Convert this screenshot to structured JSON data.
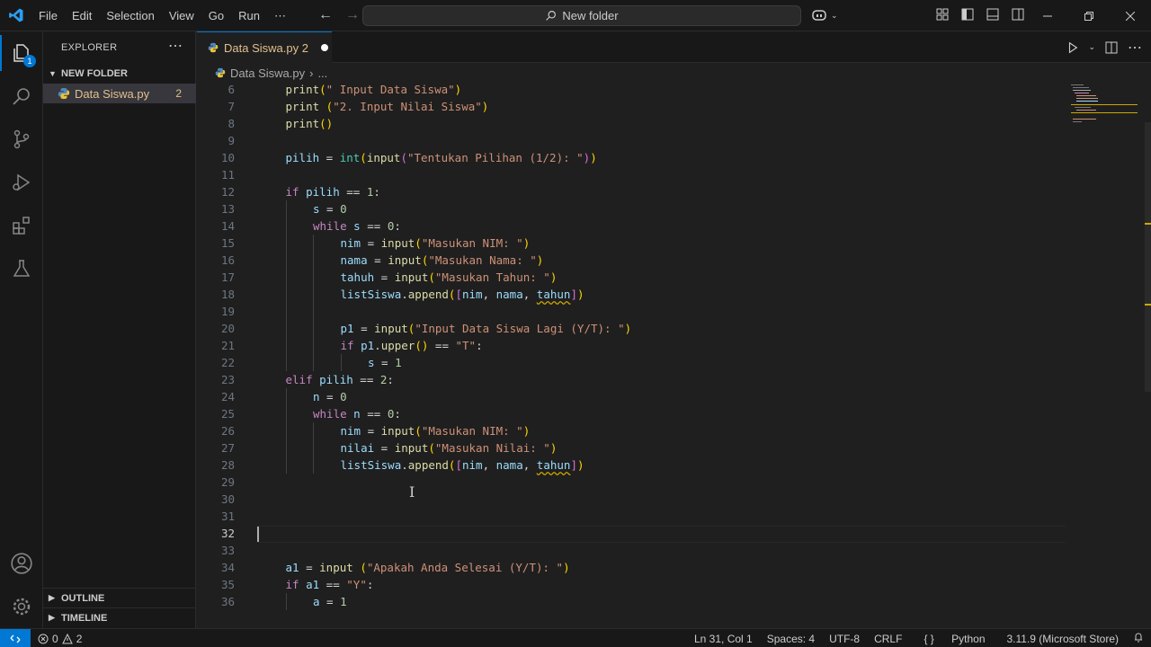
{
  "menu": [
    "File",
    "Edit",
    "Selection",
    "View",
    "Go",
    "Run"
  ],
  "search": {
    "label": "New folder"
  },
  "explorer": {
    "title": "EXPLORER",
    "folder": "NEW FOLDER",
    "file": {
      "name": "Data Siswa.py",
      "problems": "2"
    },
    "outline": "OUTLINE",
    "timeline": "TIMELINE"
  },
  "activity_badge": "1",
  "tab": {
    "label": "Data Siswa.py 2"
  },
  "breadcrumb": {
    "file": "Data Siswa.py",
    "more": "..."
  },
  "editor": {
    "current_line": 32,
    "lines": [
      {
        "n": 6,
        "indent": 1,
        "tokens": [
          [
            "fn",
            "print"
          ],
          [
            "br1",
            "("
          ],
          [
            "st",
            "\" Input Data Siswa\""
          ],
          [
            "br1",
            ")"
          ]
        ]
      },
      {
        "n": 7,
        "indent": 1,
        "tokens": [
          [
            "fn",
            "print"
          ],
          [
            "pl",
            " "
          ],
          [
            "br1",
            "("
          ],
          [
            "st",
            "\"2. Input Nilai Siswa\""
          ],
          [
            "br1",
            ")"
          ]
        ]
      },
      {
        "n": 8,
        "indent": 1,
        "tokens": [
          [
            "fn",
            "print"
          ],
          [
            "br1",
            "()"
          ]
        ]
      },
      {
        "n": 9,
        "indent": 1,
        "tokens": []
      },
      {
        "n": 10,
        "indent": 1,
        "tokens": [
          [
            "vr",
            "pilih"
          ],
          [
            "pl",
            " = "
          ],
          [
            "bi",
            "int"
          ],
          [
            "br1",
            "("
          ],
          [
            "fn",
            "input"
          ],
          [
            "br2",
            "("
          ],
          [
            "st",
            "\"Tentukan Pilihan (1/2): \""
          ],
          [
            "br2",
            ")"
          ],
          [
            "br1",
            ")"
          ]
        ]
      },
      {
        "n": 11,
        "indent": 1,
        "tokens": []
      },
      {
        "n": 12,
        "indent": 1,
        "tokens": [
          [
            "kw",
            "if"
          ],
          [
            "pl",
            " "
          ],
          [
            "vr",
            "pilih"
          ],
          [
            "pl",
            " == "
          ],
          [
            "nm",
            "1"
          ],
          [
            "pl",
            ":"
          ]
        ]
      },
      {
        "n": 13,
        "indent": 2,
        "tokens": [
          [
            "vr",
            "s"
          ],
          [
            "pl",
            " = "
          ],
          [
            "nm",
            "0"
          ]
        ]
      },
      {
        "n": 14,
        "indent": 2,
        "tokens": [
          [
            "kw",
            "while"
          ],
          [
            "pl",
            " "
          ],
          [
            "vr",
            "s"
          ],
          [
            "pl",
            " == "
          ],
          [
            "nm",
            "0"
          ],
          [
            "pl",
            ":"
          ]
        ]
      },
      {
        "n": 15,
        "indent": 3,
        "tokens": [
          [
            "vr",
            "nim"
          ],
          [
            "pl",
            " = "
          ],
          [
            "fn",
            "input"
          ],
          [
            "br1",
            "("
          ],
          [
            "st",
            "\"Masukan NIM: \""
          ],
          [
            "br1",
            ")"
          ]
        ]
      },
      {
        "n": 16,
        "indent": 3,
        "tokens": [
          [
            "vr",
            "nama"
          ],
          [
            "pl",
            " = "
          ],
          [
            "fn",
            "input"
          ],
          [
            "br1",
            "("
          ],
          [
            "st",
            "\"Masukan Nama: \""
          ],
          [
            "br1",
            ")"
          ]
        ]
      },
      {
        "n": 17,
        "indent": 3,
        "tokens": [
          [
            "vr",
            "tahuh"
          ],
          [
            "pl",
            " = "
          ],
          [
            "fn",
            "input"
          ],
          [
            "br1",
            "("
          ],
          [
            "st",
            "\"Masukan Tahun: \""
          ],
          [
            "br1",
            ")"
          ]
        ]
      },
      {
        "n": 18,
        "indent": 3,
        "tokens": [
          [
            "vr",
            "listSiswa"
          ],
          [
            "pl",
            "."
          ],
          [
            "fn",
            "append"
          ],
          [
            "br1",
            "("
          ],
          [
            "br2",
            "["
          ],
          [
            "vr",
            "nim"
          ],
          [
            "pl",
            ", "
          ],
          [
            "vr",
            "nama"
          ],
          [
            "pl",
            ", "
          ],
          [
            "vr sq",
            "tahun"
          ],
          [
            "br2",
            "]"
          ],
          [
            "br1",
            ")"
          ]
        ]
      },
      {
        "n": 19,
        "indent": 3,
        "tokens": []
      },
      {
        "n": 20,
        "indent": 3,
        "tokens": [
          [
            "vr",
            "p1"
          ],
          [
            "pl",
            " = "
          ],
          [
            "fn",
            "input"
          ],
          [
            "br1",
            "("
          ],
          [
            "st",
            "\"Input Data Siswa Lagi (Y/T): \""
          ],
          [
            "br1",
            ")"
          ]
        ]
      },
      {
        "n": 21,
        "indent": 3,
        "tokens": [
          [
            "kw",
            "if"
          ],
          [
            "pl",
            " "
          ],
          [
            "vr",
            "p1"
          ],
          [
            "pl",
            "."
          ],
          [
            "fn",
            "upper"
          ],
          [
            "br1",
            "()"
          ],
          [
            "pl",
            " == "
          ],
          [
            "st",
            "\"T\""
          ],
          [
            "pl",
            ":"
          ]
        ]
      },
      {
        "n": 22,
        "indent": 4,
        "tokens": [
          [
            "vr",
            "s"
          ],
          [
            "pl",
            " = "
          ],
          [
            "nm",
            "1"
          ]
        ]
      },
      {
        "n": 23,
        "indent": 1,
        "tokens": [
          [
            "kw",
            "elif"
          ],
          [
            "pl",
            " "
          ],
          [
            "vr",
            "pilih"
          ],
          [
            "pl",
            " == "
          ],
          [
            "nm",
            "2"
          ],
          [
            "pl",
            ":"
          ]
        ]
      },
      {
        "n": 24,
        "indent": 2,
        "tokens": [
          [
            "vr",
            "n"
          ],
          [
            "pl",
            " = "
          ],
          [
            "nm",
            "0"
          ]
        ]
      },
      {
        "n": 25,
        "indent": 2,
        "tokens": [
          [
            "kw",
            "while"
          ],
          [
            "pl",
            " "
          ],
          [
            "vr",
            "n"
          ],
          [
            "pl",
            " == "
          ],
          [
            "nm",
            "0"
          ],
          [
            "pl",
            ":"
          ]
        ]
      },
      {
        "n": 26,
        "indent": 3,
        "tokens": [
          [
            "vr",
            "nim"
          ],
          [
            "pl",
            " = "
          ],
          [
            "fn",
            "input"
          ],
          [
            "br1",
            "("
          ],
          [
            "st",
            "\"Masukan NIM: \""
          ],
          [
            "br1",
            ")"
          ]
        ]
      },
      {
        "n": 27,
        "indent": 3,
        "tokens": [
          [
            "vr",
            "nilai"
          ],
          [
            "pl",
            " = "
          ],
          [
            "fn",
            "input"
          ],
          [
            "br1",
            "("
          ],
          [
            "st",
            "\"Masukan Nilai: \""
          ],
          [
            "br1",
            ")"
          ]
        ]
      },
      {
        "n": 28,
        "indent": 3,
        "tokens": [
          [
            "vr",
            "listSiswa"
          ],
          [
            "pl",
            "."
          ],
          [
            "fn",
            "append"
          ],
          [
            "br1",
            "("
          ],
          [
            "br2",
            "["
          ],
          [
            "vr",
            "nim"
          ],
          [
            "pl",
            ", "
          ],
          [
            "vr",
            "nama"
          ],
          [
            "pl",
            ", "
          ],
          [
            "vr sq",
            "tahun"
          ],
          [
            "br2",
            "]"
          ],
          [
            "br1",
            ")"
          ]
        ]
      },
      {
        "n": 29,
        "indent": 0,
        "tokens": []
      },
      {
        "n": 30,
        "indent": 0,
        "tokens": []
      },
      {
        "n": 31,
        "indent": 0,
        "tokens": []
      },
      {
        "n": 32,
        "indent": 0,
        "tokens": []
      },
      {
        "n": 33,
        "indent": 0,
        "tokens": []
      },
      {
        "n": 34,
        "indent": 1,
        "tokens": [
          [
            "vr",
            "a1"
          ],
          [
            "pl",
            " = "
          ],
          [
            "fn",
            "input"
          ],
          [
            "pl",
            " "
          ],
          [
            "br1",
            "("
          ],
          [
            "st",
            "\"Apakah Anda Selesai (Y/T): \""
          ],
          [
            "br1",
            ")"
          ]
        ]
      },
      {
        "n": 35,
        "indent": 1,
        "tokens": [
          [
            "kw",
            "if"
          ],
          [
            "pl",
            " "
          ],
          [
            "vr",
            "a1"
          ],
          [
            "pl",
            " == "
          ],
          [
            "st",
            "\"Y\""
          ],
          [
            "pl",
            ":"
          ]
        ]
      },
      {
        "n": 36,
        "indent": 2,
        "tokens": [
          [
            "vr",
            "a"
          ],
          [
            "pl",
            " = "
          ],
          [
            "nm",
            "1"
          ]
        ]
      }
    ]
  },
  "status": {
    "errors": "0",
    "warnings": "2",
    "position": "Ln 31, Col 1",
    "spaces": "Spaces: 4",
    "encoding": "UTF-8",
    "eol": "CRLF",
    "language": "Python",
    "interpreter": "3.11.9 (Microsoft Store)"
  }
}
